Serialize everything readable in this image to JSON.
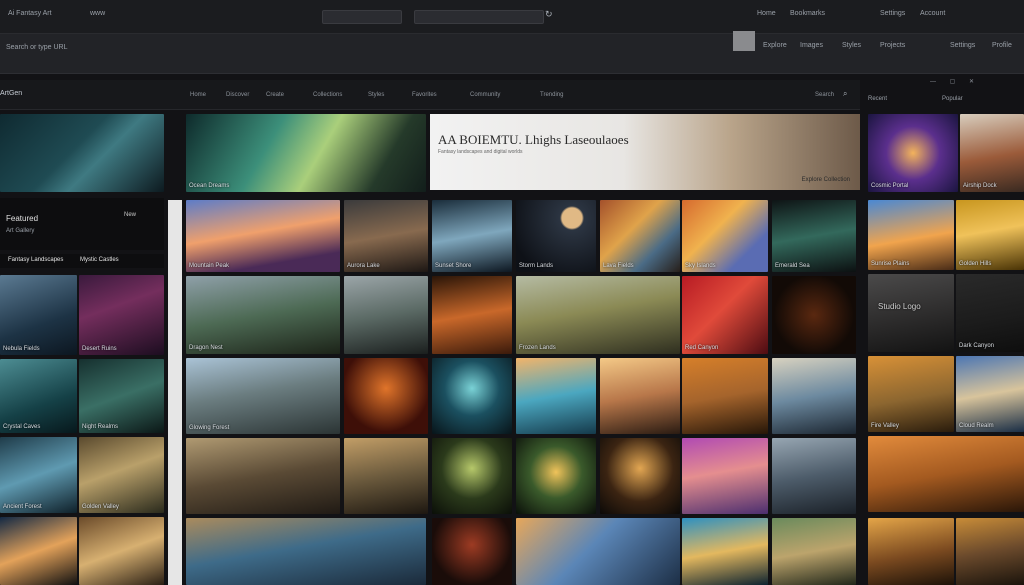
{
  "browser": {
    "tab_label": "Ai Fantasy Art",
    "url_label": "www",
    "bookmarks": [
      "Home",
      "Bookmarks",
      "Settings",
      "Account"
    ]
  },
  "toolbar": {
    "address_text": "Search or type URL",
    "items": [
      "Explore",
      "Images",
      "Styles",
      "Projects",
      "Settings",
      "Profile"
    ]
  },
  "app": {
    "brand": "ArtGen",
    "nav": [
      "Home",
      "Discover",
      "Create",
      "Collections",
      "Styles",
      "Favorites",
      "Community",
      "Trending"
    ],
    "search_label": "Search",
    "right_links": [
      "Recent",
      "Popular"
    ]
  },
  "hero": {
    "title": "AA BOIEMTU. Lhighs Laseoulaoes",
    "subtitle": "Fantasy landscapes and digital worlds",
    "cta": "Explore Collection"
  },
  "left_panel": {
    "heading": "Featured",
    "sub": "Art Gallery",
    "chip": "New"
  },
  "tiles": [
    {
      "caption": "Fantasy Landscapes"
    },
    {
      "caption": "Mystic Castles"
    },
    {
      "caption": "Nebula Fields"
    },
    {
      "caption": "Desert Ruins"
    },
    {
      "caption": "Crystal Caves"
    },
    {
      "caption": "Night Realms"
    },
    {
      "caption": "Ancient Forest"
    },
    {
      "caption": "Golden Valley"
    },
    {
      "caption": "Ocean Dreams"
    },
    {
      "caption": "Mountain Peak"
    },
    {
      "caption": "Aurora Lake"
    },
    {
      "caption": "Sunset Shore"
    },
    {
      "caption": "Storm Lands"
    },
    {
      "caption": "Lava Fields"
    },
    {
      "caption": "Sky Islands"
    },
    {
      "caption": "Emerald Sea"
    },
    {
      "caption": "Dragon Nest"
    },
    {
      "caption": "Frozen Lands"
    },
    {
      "caption": "Red Canyon"
    },
    {
      "caption": "Glowing Forest"
    }
  ],
  "right_cards": [
    {
      "caption": "Cosmic Portal"
    },
    {
      "caption": "Airship Dock"
    },
    {
      "caption": "Sunrise Plains"
    },
    {
      "caption": "Golden Hills"
    },
    {
      "caption": "Studio Logo"
    },
    {
      "caption": "Dark Canyon"
    },
    {
      "caption": "Fire Valley"
    },
    {
      "caption": "Cloud Realm"
    }
  ]
}
